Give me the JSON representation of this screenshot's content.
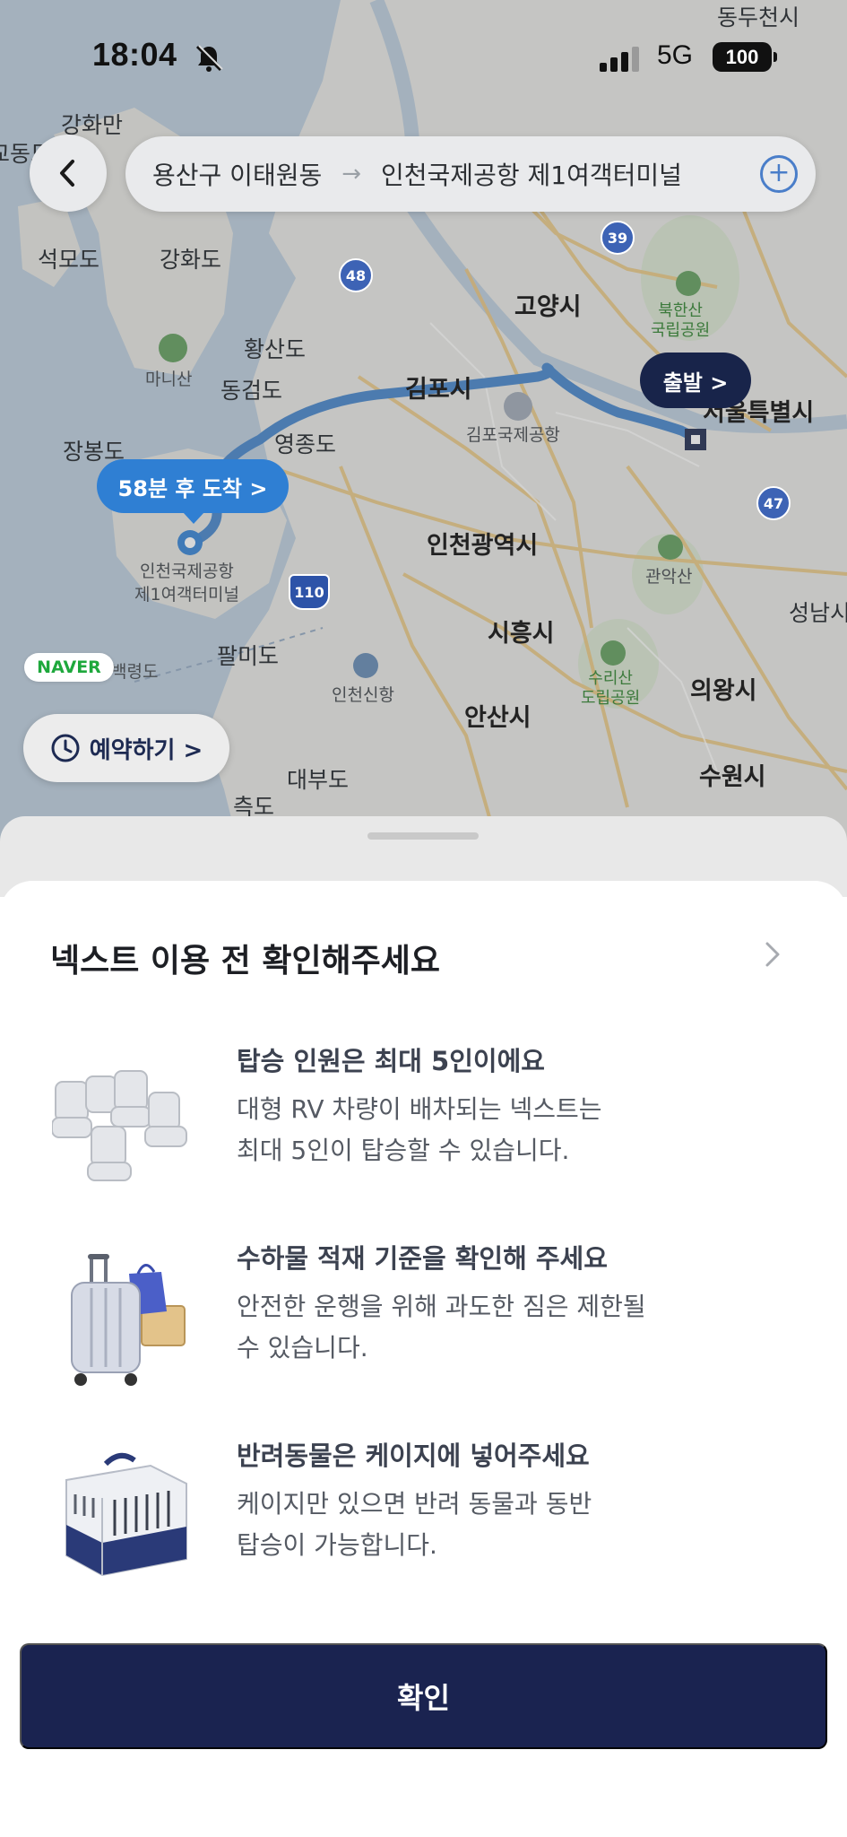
{
  "status_bar": {
    "time": "18:04",
    "network": "5G",
    "battery": "100",
    "icons": [
      "bell-muted-icon",
      "signal-icon"
    ]
  },
  "route": {
    "from": "용산구 이태원동",
    "arrow": "→",
    "to": "인천국제공항 제1여객터미널",
    "add_icon": "+"
  },
  "map": {
    "places": {
      "dongducheon": "동두천시",
      "ganghwa_top": "강화만",
      "gyodong": "교동도",
      "seongmodo": "석모도",
      "ganghwado": "강화도",
      "hwangsando": "황산도",
      "manisan": "마니산",
      "donggeomdo": "동검도",
      "gimpo": "김포시",
      "goyang": "고양시",
      "bukhansan": "북한산\n국립공원",
      "seoul": "서울특별시",
      "jangbongdo": "장봉도",
      "yeongjongdo": "영종도",
      "gimpo_airport": "김포국제공항",
      "incheon": "인천광역시",
      "airport_t1": "인천국제공항\n제1여객터미널",
      "gwanaksan": "관악산",
      "seongnam": "성남시",
      "siheung": "시흥시",
      "palmido": "팔미도",
      "baengnyeong": "백령도",
      "incheon_port": "인천신항",
      "surisan": "수리산\n도립공원",
      "uiwang": "의왕시",
      "ansan": "안산시",
      "daebudo": "대부도",
      "cheukdo": "측도",
      "suwon": "수원시"
    },
    "route_shields": [
      "48",
      "39",
      "47",
      "110"
    ],
    "depart_label": "출발 >",
    "arrive_label": "58분 후 도착 >",
    "naver_badge": "NAVER",
    "reserve_label": "예약하기 >"
  },
  "sheet": {
    "title": "넥스트 이용 전 확인해주세요",
    "items": [
      {
        "icon": "car-seats-icon",
        "heading": "탑승 인원은 최대 5인이에요",
        "line1": "대형 RV 차량이 배차되는 넥스트는",
        "line2": "최대 5인이 탑승할 수 있습니다."
      },
      {
        "icon": "luggage-icon",
        "heading": "수하물 적재 기준을 확인해 주세요",
        "line1": "안전한 운행을 위해 과도한 짐은 제한될",
        "line2": "수 있습니다."
      },
      {
        "icon": "pet-carrier-icon",
        "heading": "반려동물은 케이지에 넣어주세요",
        "line1": "케이지만 있으면 반려 동물과 동반",
        "line2": "탑승이 가능합니다."
      }
    ],
    "confirm_label": "확인"
  },
  "colors": {
    "route_line": "#3f80c8",
    "depart_bubble": "#18244a",
    "arrive_bubble": "#2f7fd3",
    "confirm_button": "#1a2350",
    "sea": "#b9cbdc",
    "land": "#e6e7e3"
  }
}
